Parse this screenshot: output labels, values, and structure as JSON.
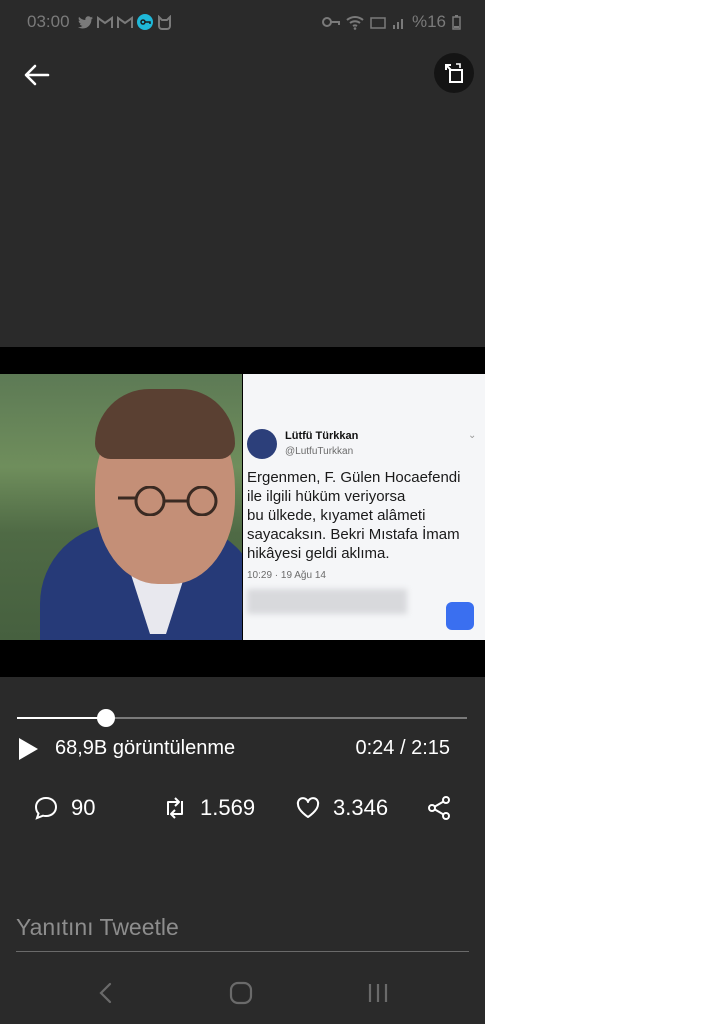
{
  "status_bar": {
    "time": "03:00",
    "battery": "%16",
    "left_icons": [
      "twitter-icon",
      "gmail-icon",
      "gmail-icon",
      "vpn-key-icon",
      "cat-icon"
    ],
    "right_icons": [
      "key-icon",
      "wifi-icon",
      "signal-icon",
      "battery-icon"
    ]
  },
  "video": {
    "embedded_tweet": {
      "name": "Lütfü Türkkan",
      "handle": "@LutfuTurkkan",
      "text": "Ergenmen, F. Gülen Hocaefendi\nile ilgili hüküm veriyorsa\nbu ülkede, kıyamet alâmeti\nsayacaksın. Bekri Mıstafa İmam\nhikâyesi geldi aklıma.",
      "date": "10:29 · 19 Ağu 14"
    },
    "progress_fraction": 0.197
  },
  "player": {
    "views": "68,9B görüntülenme",
    "time": "0:24 / 2:15"
  },
  "actions": {
    "replies": "90",
    "retweets": "1.569",
    "likes": "3.346"
  },
  "reply_placeholder": "Yanıtını Tweetle",
  "colors": {
    "background": "#2a2a2a",
    "accent_vpn": "#1fb8d8",
    "text": "#ffffff"
  }
}
